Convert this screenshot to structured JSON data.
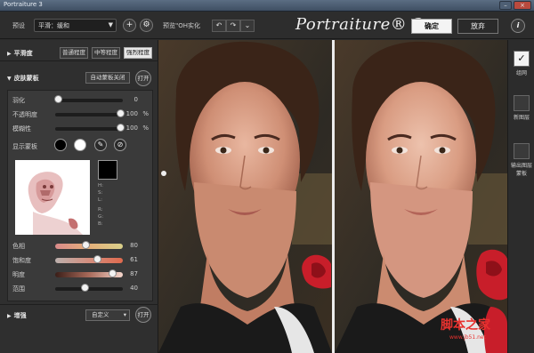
{
  "window": {
    "title": "Portraiture 3"
  },
  "toolbar": {
    "preset_label": "预设",
    "preset_value": "平滑：缓和",
    "preview_label": "预览\"OH实化",
    "logo": "Portraiture® 3",
    "ok_label": "确定",
    "cancel_label": "放弃",
    "info_label": "i"
  },
  "smoothing": {
    "title": "平滑度",
    "level_buttons": [
      "普通程度",
      "中等程度",
      "强烈程度"
    ],
    "active_level": 2
  },
  "skin_mask": {
    "title": "皮肤蒙板",
    "auto_button": "自动蒙板关闭",
    "open_button": "打开",
    "sliders": [
      {
        "label": "羽化",
        "value": "0",
        "unit": "",
        "level": 0.0
      },
      {
        "label": "不透明度",
        "value": "100",
        "unit": "%",
        "level": 1.0
      },
      {
        "label": "模糊性",
        "value": "100",
        "unit": "%",
        "level": 1.0
      }
    ],
    "show_mask_label": "显示蒙板",
    "hsl_labels": [
      "H:",
      "S:",
      "L:",
      "R:",
      "G:",
      "B:"
    ],
    "color_sliders": [
      {
        "label": "色相",
        "value": "80",
        "level": 0.44,
        "gradient": "linear-gradient(90deg,#d98a8a,#e6b07a,#d9d08a)"
      },
      {
        "label": "饱和度",
        "value": "61",
        "level": 0.62,
        "gradient": "linear-gradient(90deg,#bcb0ad,#d48e7e,#e06a4e)"
      },
      {
        "label": "明度",
        "value": "87",
        "level": 0.88,
        "gradient": "linear-gradient(90deg,#3a1e18,#a86a5a,#f5d6cc)"
      },
      {
        "label": "范围",
        "value": "40",
        "level": 0.4,
        "gradient": "linear-gradient(90deg,#1e1e1e,#1e1e1e)"
      }
    ]
  },
  "enhance": {
    "title": "增强",
    "preset_value": "自定义",
    "open_button": "打开"
  },
  "right_panel": {
    "items": [
      {
        "label": "组网",
        "checked": true
      },
      {
        "label": "新图层",
        "checked": false
      },
      {
        "label": "输出图层蒙板",
        "checked": false
      }
    ]
  },
  "watermark": {
    "text": "脚本之家",
    "url": "www.jb51.net"
  }
}
